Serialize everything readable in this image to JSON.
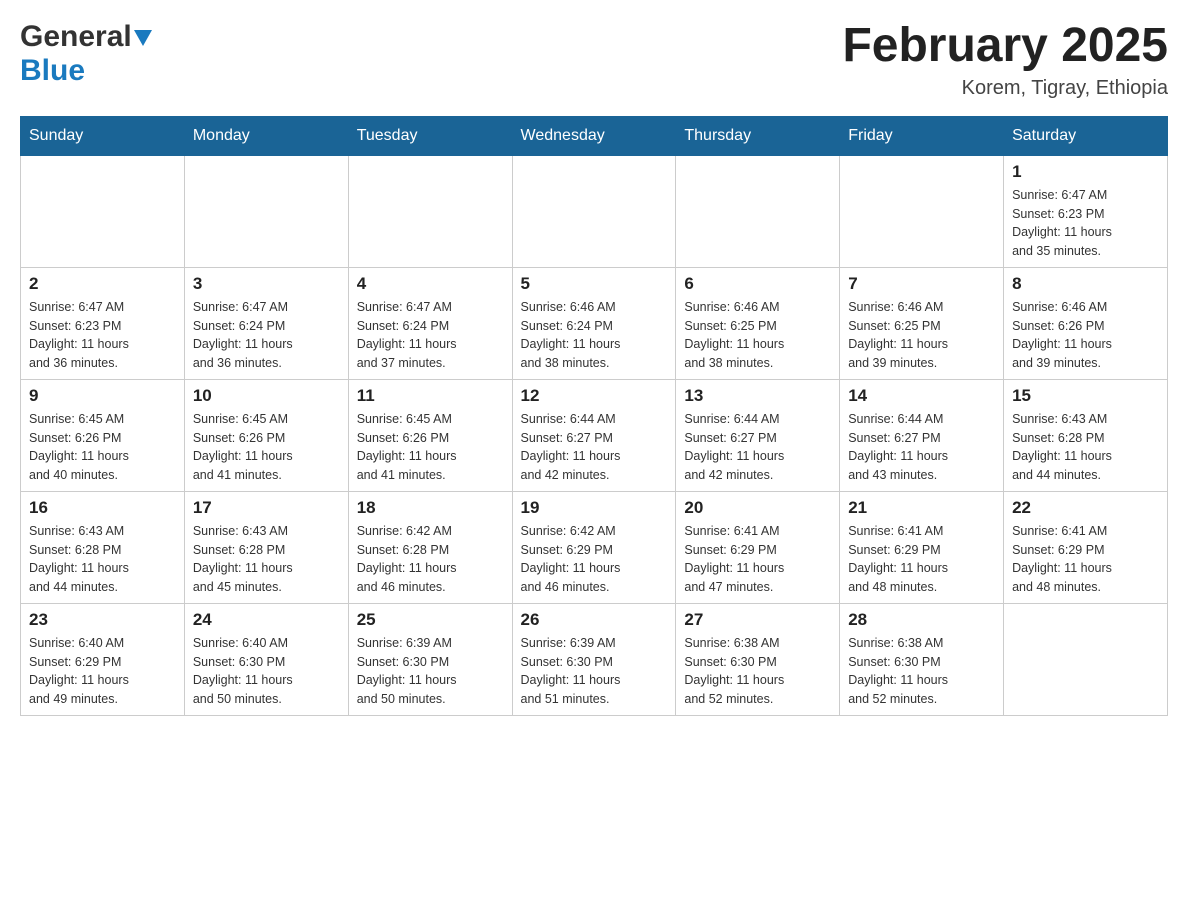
{
  "header": {
    "logo_general": "General",
    "logo_blue": "Blue",
    "title": "February 2025",
    "subtitle": "Korem, Tigray, Ethiopia"
  },
  "days_of_week": [
    "Sunday",
    "Monday",
    "Tuesday",
    "Wednesday",
    "Thursday",
    "Friday",
    "Saturday"
  ],
  "weeks": [
    {
      "days": [
        {
          "num": "",
          "info": ""
        },
        {
          "num": "",
          "info": ""
        },
        {
          "num": "",
          "info": ""
        },
        {
          "num": "",
          "info": ""
        },
        {
          "num": "",
          "info": ""
        },
        {
          "num": "",
          "info": ""
        },
        {
          "num": "1",
          "info": "Sunrise: 6:47 AM\nSunset: 6:23 PM\nDaylight: 11 hours\nand 35 minutes."
        }
      ]
    },
    {
      "days": [
        {
          "num": "2",
          "info": "Sunrise: 6:47 AM\nSunset: 6:23 PM\nDaylight: 11 hours\nand 36 minutes."
        },
        {
          "num": "3",
          "info": "Sunrise: 6:47 AM\nSunset: 6:24 PM\nDaylight: 11 hours\nand 36 minutes."
        },
        {
          "num": "4",
          "info": "Sunrise: 6:47 AM\nSunset: 6:24 PM\nDaylight: 11 hours\nand 37 minutes."
        },
        {
          "num": "5",
          "info": "Sunrise: 6:46 AM\nSunset: 6:24 PM\nDaylight: 11 hours\nand 38 minutes."
        },
        {
          "num": "6",
          "info": "Sunrise: 6:46 AM\nSunset: 6:25 PM\nDaylight: 11 hours\nand 38 minutes."
        },
        {
          "num": "7",
          "info": "Sunrise: 6:46 AM\nSunset: 6:25 PM\nDaylight: 11 hours\nand 39 minutes."
        },
        {
          "num": "8",
          "info": "Sunrise: 6:46 AM\nSunset: 6:26 PM\nDaylight: 11 hours\nand 39 minutes."
        }
      ]
    },
    {
      "days": [
        {
          "num": "9",
          "info": "Sunrise: 6:45 AM\nSunset: 6:26 PM\nDaylight: 11 hours\nand 40 minutes."
        },
        {
          "num": "10",
          "info": "Sunrise: 6:45 AM\nSunset: 6:26 PM\nDaylight: 11 hours\nand 41 minutes."
        },
        {
          "num": "11",
          "info": "Sunrise: 6:45 AM\nSunset: 6:26 PM\nDaylight: 11 hours\nand 41 minutes."
        },
        {
          "num": "12",
          "info": "Sunrise: 6:44 AM\nSunset: 6:27 PM\nDaylight: 11 hours\nand 42 minutes."
        },
        {
          "num": "13",
          "info": "Sunrise: 6:44 AM\nSunset: 6:27 PM\nDaylight: 11 hours\nand 42 minutes."
        },
        {
          "num": "14",
          "info": "Sunrise: 6:44 AM\nSunset: 6:27 PM\nDaylight: 11 hours\nand 43 minutes."
        },
        {
          "num": "15",
          "info": "Sunrise: 6:43 AM\nSunset: 6:28 PM\nDaylight: 11 hours\nand 44 minutes."
        }
      ]
    },
    {
      "days": [
        {
          "num": "16",
          "info": "Sunrise: 6:43 AM\nSunset: 6:28 PM\nDaylight: 11 hours\nand 44 minutes."
        },
        {
          "num": "17",
          "info": "Sunrise: 6:43 AM\nSunset: 6:28 PM\nDaylight: 11 hours\nand 45 minutes."
        },
        {
          "num": "18",
          "info": "Sunrise: 6:42 AM\nSunset: 6:28 PM\nDaylight: 11 hours\nand 46 minutes."
        },
        {
          "num": "19",
          "info": "Sunrise: 6:42 AM\nSunset: 6:29 PM\nDaylight: 11 hours\nand 46 minutes."
        },
        {
          "num": "20",
          "info": "Sunrise: 6:41 AM\nSunset: 6:29 PM\nDaylight: 11 hours\nand 47 minutes."
        },
        {
          "num": "21",
          "info": "Sunrise: 6:41 AM\nSunset: 6:29 PM\nDaylight: 11 hours\nand 48 minutes."
        },
        {
          "num": "22",
          "info": "Sunrise: 6:41 AM\nSunset: 6:29 PM\nDaylight: 11 hours\nand 48 minutes."
        }
      ]
    },
    {
      "days": [
        {
          "num": "23",
          "info": "Sunrise: 6:40 AM\nSunset: 6:29 PM\nDaylight: 11 hours\nand 49 minutes."
        },
        {
          "num": "24",
          "info": "Sunrise: 6:40 AM\nSunset: 6:30 PM\nDaylight: 11 hours\nand 50 minutes."
        },
        {
          "num": "25",
          "info": "Sunrise: 6:39 AM\nSunset: 6:30 PM\nDaylight: 11 hours\nand 50 minutes."
        },
        {
          "num": "26",
          "info": "Sunrise: 6:39 AM\nSunset: 6:30 PM\nDaylight: 11 hours\nand 51 minutes."
        },
        {
          "num": "27",
          "info": "Sunrise: 6:38 AM\nSunset: 6:30 PM\nDaylight: 11 hours\nand 52 minutes."
        },
        {
          "num": "28",
          "info": "Sunrise: 6:38 AM\nSunset: 6:30 PM\nDaylight: 11 hours\nand 52 minutes."
        },
        {
          "num": "",
          "info": ""
        }
      ]
    }
  ]
}
